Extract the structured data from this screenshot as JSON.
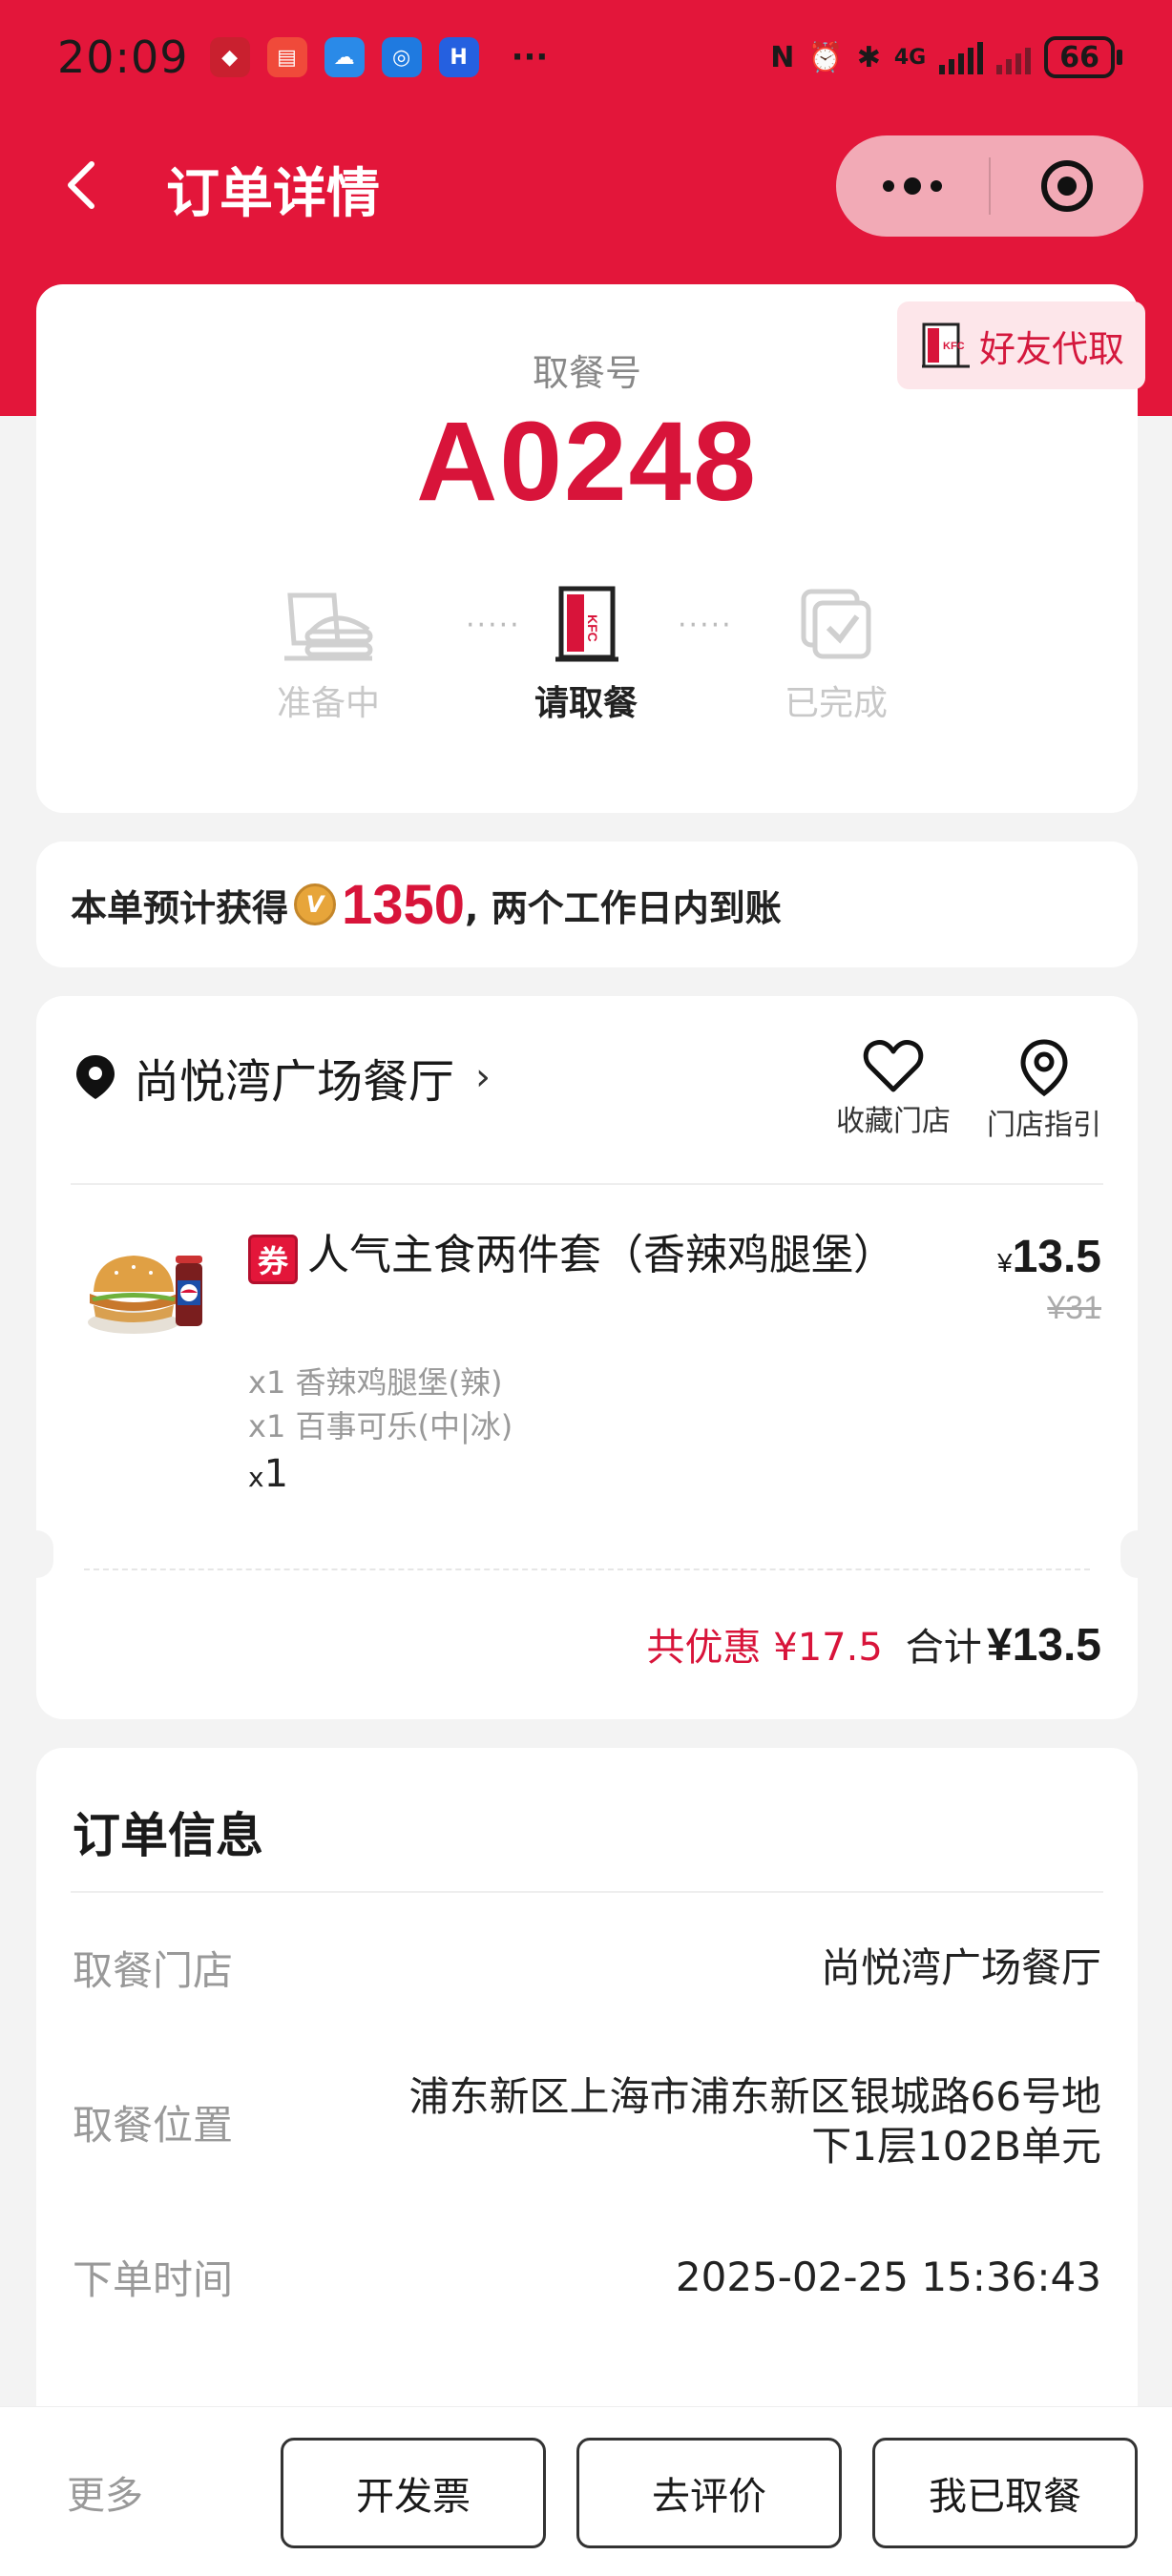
{
  "status_bar": {
    "time": "20:09",
    "more": "···",
    "network": "4G",
    "battery": "66"
  },
  "nav": {
    "title": "订单详情"
  },
  "pickup": {
    "friend_label": "好友代取",
    "label": "取餐号",
    "number": "A0248",
    "steps": [
      {
        "label": "准备中",
        "active": false
      },
      {
        "label": "请取餐",
        "active": true
      },
      {
        "label": "已完成",
        "active": false
      }
    ],
    "step_dots": "·····"
  },
  "points": {
    "prefix": "本单预计获得",
    "coin_icon": "V",
    "value": "1350",
    "suffix": ", 两个工作日内到账"
  },
  "order": {
    "store_name": "尚悦湾广场餐厅",
    "store_chevron": "›",
    "favorite_label": "收藏门店",
    "guide_label": "门店指引",
    "item": {
      "coupon_tag": "券",
      "name": "人气主食两件套（香辣鸡腿堡）",
      "price_symbol": "¥",
      "price": "13.5",
      "original_price": "¥31",
      "sub_items": [
        "x1 香辣鸡腿堡(辣)",
        "x1 百事可乐(中|冰)"
      ],
      "qty_prefix": "x",
      "qty": "1"
    },
    "discount": "共优惠 ¥17.5",
    "total_label": "合计",
    "total_value": "¥13.5"
  },
  "info": {
    "title": "订单信息",
    "rows": [
      {
        "key": "取餐门店",
        "value": "尚悦湾广场餐厅"
      },
      {
        "key": "取餐位置",
        "value": "浦东新区上海市浦东新区银城路66号地下1层102B单元"
      },
      {
        "key": "下单时间",
        "value": "2025-02-25 15:36:43"
      }
    ]
  },
  "bottom": {
    "more": "更多",
    "invoice": "开发票",
    "review": "去评价",
    "picked_up": "我已取餐"
  },
  "colors": {
    "brand_red": "#e3163a",
    "price_red": "#d8143a"
  }
}
